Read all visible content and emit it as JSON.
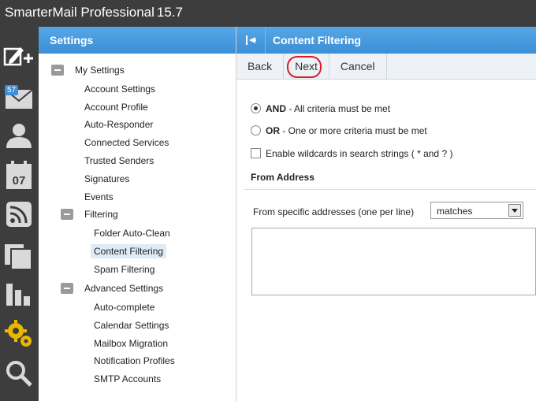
{
  "app": {
    "name": "SmarterMail Professional",
    "version": "15.7"
  },
  "rail": {
    "mail_badge": "57",
    "calendar_day": "07",
    "icons": [
      "compose-icon",
      "mail-icon",
      "contacts-icon",
      "calendar-icon",
      "rss-icon",
      "files-icon",
      "reports-icon",
      "settings-icon",
      "search-icon"
    ]
  },
  "settings": {
    "title": "Settings",
    "tree": {
      "my_settings": "My Settings",
      "account_settings": "Account Settings",
      "account_profile": "Account Profile",
      "auto_responder": "Auto-Responder",
      "connected_services": "Connected Services",
      "trusted_senders": "Trusted Senders",
      "signatures": "Signatures",
      "events": "Events",
      "filtering": "Filtering",
      "folder_auto_clean": "Folder Auto-Clean",
      "content_filtering": "Content Filtering",
      "spam_filtering": "Spam Filtering",
      "advanced_settings": "Advanced Settings",
      "auto_complete": "Auto-complete",
      "calendar_settings": "Calendar Settings",
      "mailbox_migration": "Mailbox Migration",
      "notification_profiles": "Notification Profiles",
      "smtp_accounts": "SMTP Accounts"
    }
  },
  "content": {
    "title": "Content Filtering",
    "toolbar": {
      "back": "Back",
      "next": "Next",
      "cancel": "Cancel"
    },
    "options": {
      "and_bold": "AND",
      "and_text": " - All criteria must be met",
      "or_bold": "OR",
      "or_text": " - One or more criteria must be met",
      "wildcards": "Enable wildcards in search strings ( * and ? )"
    },
    "from_address": {
      "title": "From Address",
      "label": "From specific addresses (one per line)",
      "match_value": "matches",
      "addresses": ""
    }
  },
  "colors": {
    "accent": "#4a9de0",
    "highlight": "#d81e2a",
    "selected_bg": "#dcebf7"
  }
}
